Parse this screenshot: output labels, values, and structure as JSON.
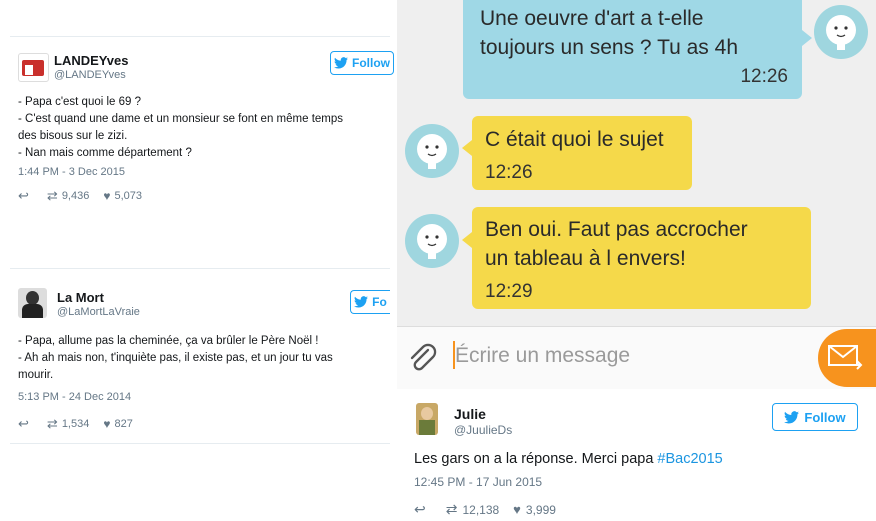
{
  "tweets": [
    {
      "name": "LANDEYves",
      "handle": "@LANDEYves",
      "follow": "Follow",
      "lines": [
        "- Papa c'est quoi le 69 ?",
        "- C'est quand une dame et un monsieur se font en même temps",
        "des bisous sur le zizi.",
        "- Nan mais comme département ?"
      ],
      "time": "1:44 PM - 3 Dec 2015",
      "retweets": "9,436",
      "likes": "5,073"
    },
    {
      "name": "La Mort",
      "handle": "@LaMortLaVraie",
      "follow": "Fo",
      "lines": [
        "- Papa, allume pas la cheminée, ça va brûler le Père Noël !",
        "- Ah ah mais non, t'inquiète pas, il existe pas, et un jour tu vas",
        "mourir."
      ],
      "time": "5:13 PM - 24 Dec 2014",
      "retweets": "1,534",
      "likes": "827"
    },
    {
      "name": "Julie",
      "handle": "@JuulieDs",
      "follow": "Follow",
      "text_before": "Les gars on a la réponse. Merci papa ",
      "hashtag": "#Bac2015",
      "time": "12:45 PM - 17 Jun 2015",
      "retweets": "12,138",
      "likes": "3,999"
    }
  ],
  "chat": {
    "messages": [
      {
        "lines": [
          "Une oeuvre d'art a t-elle",
          "toujours un sens ? Tu as 4h"
        ],
        "time": "12:26",
        "side": "right",
        "color": "#9fd8e6"
      },
      {
        "lines": [
          "C était quoi le sujet"
        ],
        "time": "12:26",
        "side": "left",
        "color": "#f5d94a"
      },
      {
        "lines": [
          "Ben oui. Faut  pas accrocher",
          "un tableau à l envers!"
        ],
        "time": "12:29",
        "side": "left",
        "color": "#f5d94a"
      }
    ],
    "input_placeholder": "Écrire un message",
    "send_color": "#f7931e"
  },
  "colors": {
    "twitter_blue": "#1da1f2",
    "hashtag": "#1b95e0"
  }
}
